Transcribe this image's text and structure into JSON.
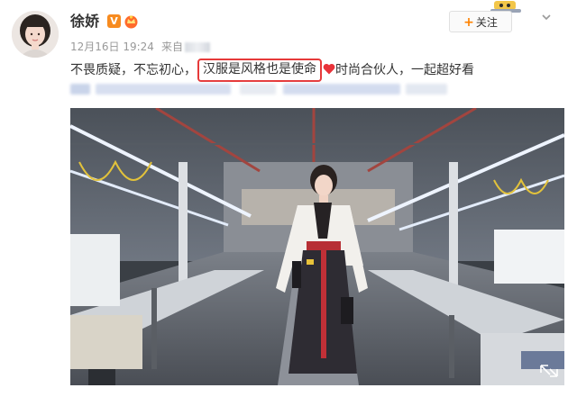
{
  "post": {
    "username": "徐娇",
    "badge_v": "V",
    "date": "12月16日 19:24",
    "from_prefix": "来自",
    "follow_plus": "+",
    "follow_label": "关注",
    "text_before": "不畏质疑，不忘初心，",
    "text_highlight": "汉服是风格也是使命",
    "text_after": "时尚合伙人，一起超好看"
  },
  "colors": {
    "accent_orange": "#ff8200",
    "highlight_red": "#e63a3a",
    "verified_badge": "#f78b1f"
  },
  "icons": [
    "verified-v-icon",
    "member-crown-icon",
    "plus-icon",
    "chevron-down-icon",
    "heart-icon",
    "fullscreen-icon"
  ]
}
